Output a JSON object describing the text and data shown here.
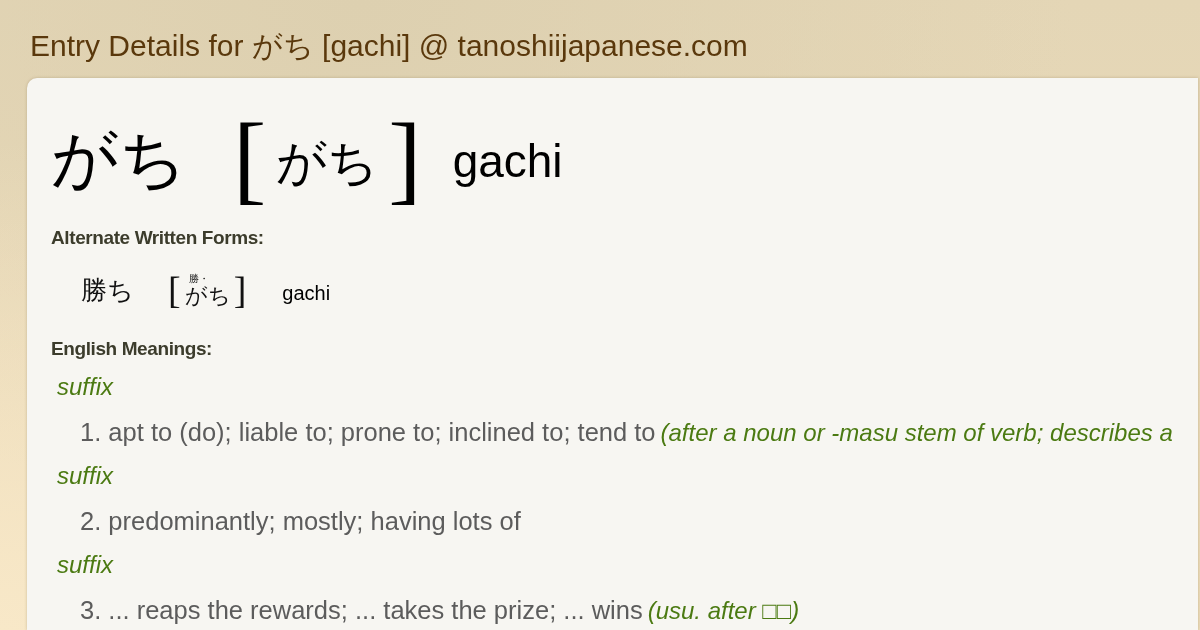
{
  "page_title": "Entry Details for がち [gachi] @ tanoshiijapanese.com",
  "entry": {
    "word": "がち",
    "bracket_open": "[",
    "reading": "がち",
    "bracket_close": "]",
    "romaji": "gachi"
  },
  "alternate_forms": {
    "label": "Alternate Written Forms:",
    "items": [
      {
        "word": "勝ち",
        "bracket_open": "[",
        "furigana": "勝・",
        "reading": "がち",
        "bracket_close": "]",
        "romaji": "gachi"
      }
    ]
  },
  "english_meanings": {
    "label": "English Meanings:",
    "senses": [
      {
        "part_of_speech": "suffix",
        "number": "1.",
        "gloss": "apt to (do); liable to; prone to; inclined to; tend to",
        "note": "(after a noun or -masu stem of verb; describes a"
      },
      {
        "part_of_speech": "suffix",
        "number": "2.",
        "gloss": "predominantly; mostly; having lots of"
      },
      {
        "part_of_speech": "suffix",
        "number": "3.",
        "gloss": "... reaps the rewards; ... takes the prize; ... wins",
        "note": "(usu. after □□)"
      }
    ]
  }
}
